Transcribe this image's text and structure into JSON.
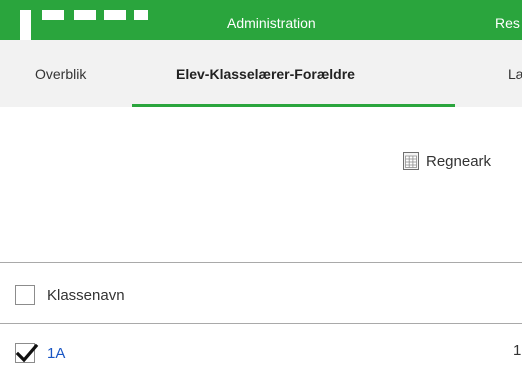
{
  "topnav": {
    "items": [
      {
        "label": "Administration"
      },
      {
        "label": "Res"
      }
    ]
  },
  "tabs": [
    {
      "label": "Overblik",
      "active": false
    },
    {
      "label": "Elev-Klasselærer-Forældre",
      "active": true
    },
    {
      "label": "Læ",
      "active": false
    }
  ],
  "toolbar": {
    "spreadsheet_label": "Regneark",
    "spreadsheet_icon": "spreadsheet-icon"
  },
  "table": {
    "header": {
      "label": "Klassenavn",
      "checked": false
    },
    "rows": [
      {
        "name": "1A",
        "checked": true,
        "count": "1"
      }
    ]
  },
  "colors": {
    "brand_green": "#2aa53d",
    "link_blue": "#1a56c4",
    "tabbar_bg": "#f2f2f2"
  }
}
